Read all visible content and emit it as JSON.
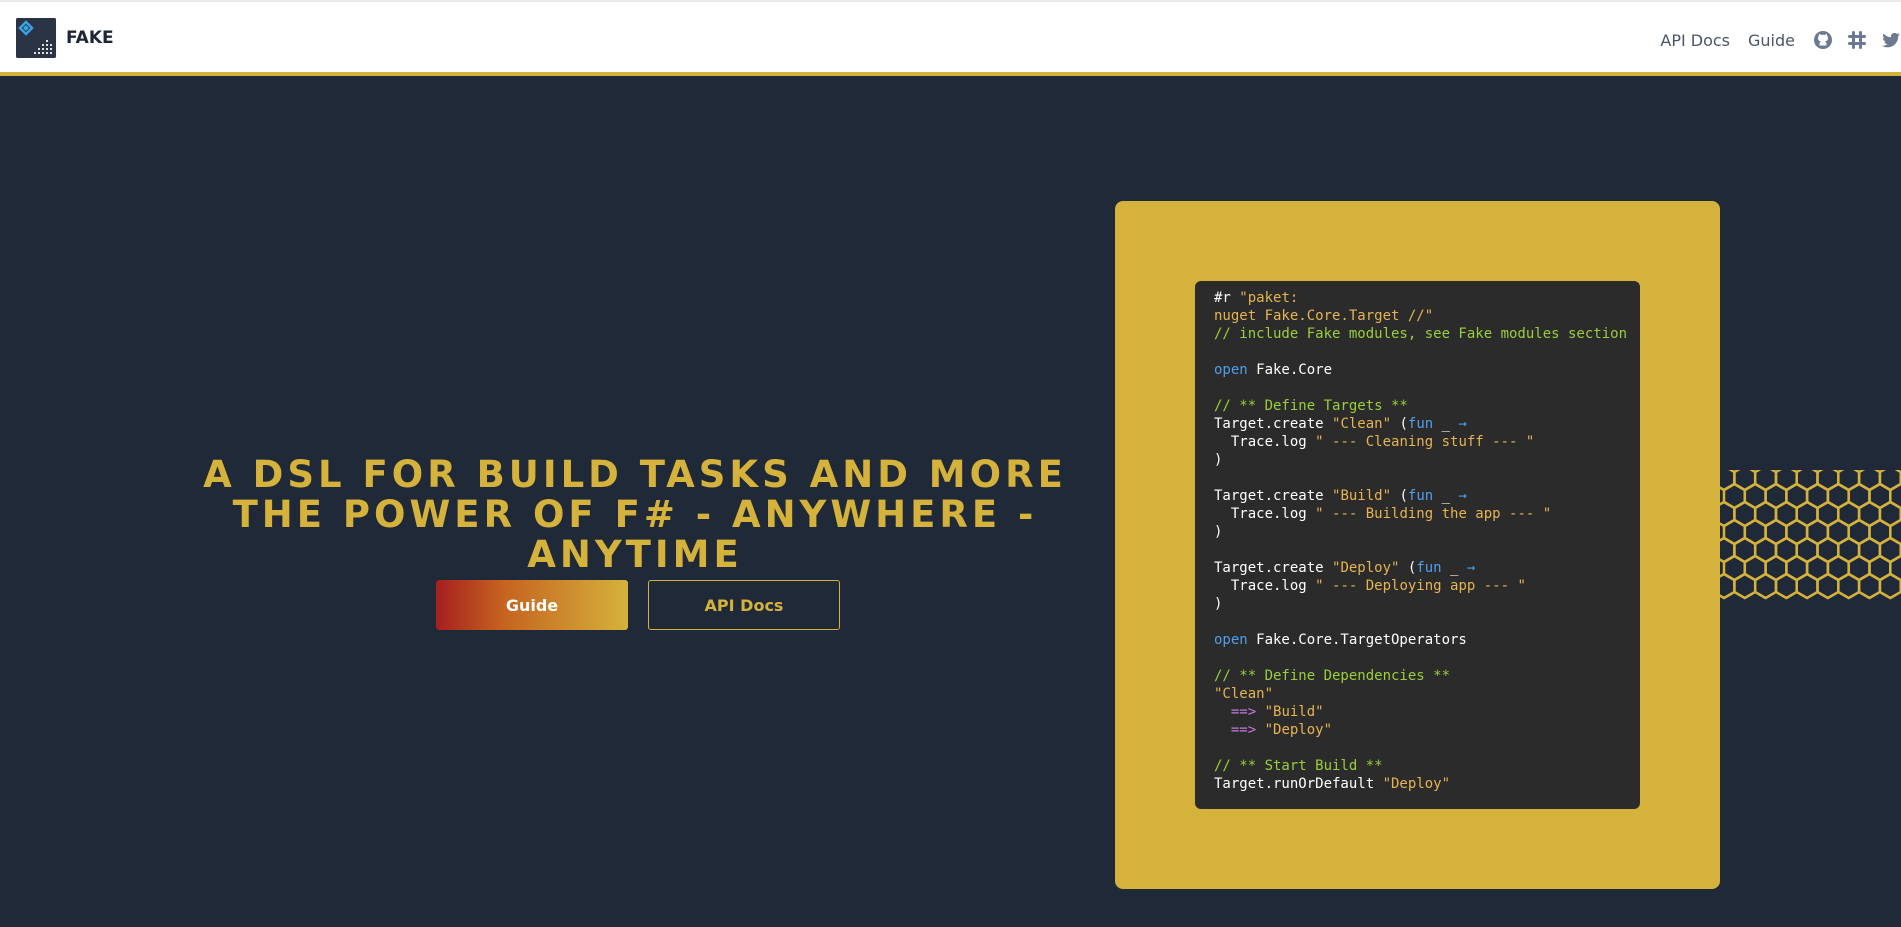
{
  "header": {
    "brand_name": "FAKE",
    "logo_icon": "fake-logo-icon",
    "nav_links": [
      {
        "label": "API Docs"
      },
      {
        "label": "Guide"
      }
    ],
    "social_icons": [
      "github-icon",
      "slack-icon",
      "twitter-icon"
    ],
    "accent_color": "#d5b23b"
  },
  "hero": {
    "title_line_1": "A DSL FOR BUILD TASKS AND MORE",
    "title_line_2": "THE POWER OF F# - ANYWHERE - ANYTIME",
    "guide_button": "Guide",
    "api_docs_button": "API Docs"
  },
  "code_sample": {
    "lines": [
      [
        {
          "t": "#r ",
          "c": "plain"
        },
        {
          "t": "\"paket:",
          "c": "string"
        }
      ],
      [
        {
          "t": "nuget Fake.Core.Target //\"",
          "c": "string"
        }
      ],
      [
        {
          "t": "// include Fake modules, see Fake modules section",
          "c": "comment"
        }
      ],
      [],
      [
        {
          "t": "open",
          "c": "keyword"
        },
        {
          "t": " Fake.Core",
          "c": "plain"
        }
      ],
      [],
      [
        {
          "t": "// ** Define Targets **",
          "c": "comment"
        }
      ],
      [
        {
          "t": "Target.create ",
          "c": "plain"
        },
        {
          "t": "\"Clean\"",
          "c": "string"
        },
        {
          "t": " (",
          "c": "plain"
        },
        {
          "t": "fun",
          "c": "keyword"
        },
        {
          "t": " _ ",
          "c": "plain"
        },
        {
          "t": "→",
          "c": "keyword"
        }
      ],
      [
        {
          "t": "  Trace.log ",
          "c": "plain"
        },
        {
          "t": "\" --- Cleaning stuff --- \"",
          "c": "string"
        }
      ],
      [
        {
          "t": ")",
          "c": "plain"
        }
      ],
      [],
      [
        {
          "t": "Target.create ",
          "c": "plain"
        },
        {
          "t": "\"Build\"",
          "c": "string"
        },
        {
          "t": " (",
          "c": "plain"
        },
        {
          "t": "fun",
          "c": "keyword"
        },
        {
          "t": " _ ",
          "c": "plain"
        },
        {
          "t": "→",
          "c": "keyword"
        }
      ],
      [
        {
          "t": "  Trace.log ",
          "c": "plain"
        },
        {
          "t": "\" --- Building the app --- \"",
          "c": "string"
        }
      ],
      [
        {
          "t": ")",
          "c": "plain"
        }
      ],
      [],
      [
        {
          "t": "Target.create ",
          "c": "plain"
        },
        {
          "t": "\"Deploy\"",
          "c": "string"
        },
        {
          "t": " (",
          "c": "plain"
        },
        {
          "t": "fun",
          "c": "keyword"
        },
        {
          "t": " _ ",
          "c": "plain"
        },
        {
          "t": "→",
          "c": "keyword"
        }
      ],
      [
        {
          "t": "  Trace.log ",
          "c": "plain"
        },
        {
          "t": "\" --- Deploying app --- \"",
          "c": "string"
        }
      ],
      [
        {
          "t": ")",
          "c": "plain"
        }
      ],
      [],
      [
        {
          "t": "open",
          "c": "keyword"
        },
        {
          "t": " Fake.Core.TargetOperators",
          "c": "plain"
        }
      ],
      [],
      [
        {
          "t": "// ** Define Dependencies **",
          "c": "comment"
        }
      ],
      [
        {
          "t": "\"Clean\"",
          "c": "string"
        }
      ],
      [
        {
          "t": "  ",
          "c": "plain"
        },
        {
          "t": "==>",
          "c": "op"
        },
        {
          "t": " ",
          "c": "plain"
        },
        {
          "t": "\"Build\"",
          "c": "string"
        }
      ],
      [
        {
          "t": "  ",
          "c": "plain"
        },
        {
          "t": "==>",
          "c": "op"
        },
        {
          "t": " ",
          "c": "plain"
        },
        {
          "t": "\"Deploy\"",
          "c": "string"
        }
      ],
      [],
      [
        {
          "t": "// ** Start Build **",
          "c": "comment"
        }
      ],
      [
        {
          "t": "Target.runOrDefault ",
          "c": "plain"
        },
        {
          "t": "\"Deploy\"",
          "c": "string"
        }
      ]
    ]
  },
  "decoration": {
    "honeycomb_icon": "honeycomb-pattern-icon"
  }
}
